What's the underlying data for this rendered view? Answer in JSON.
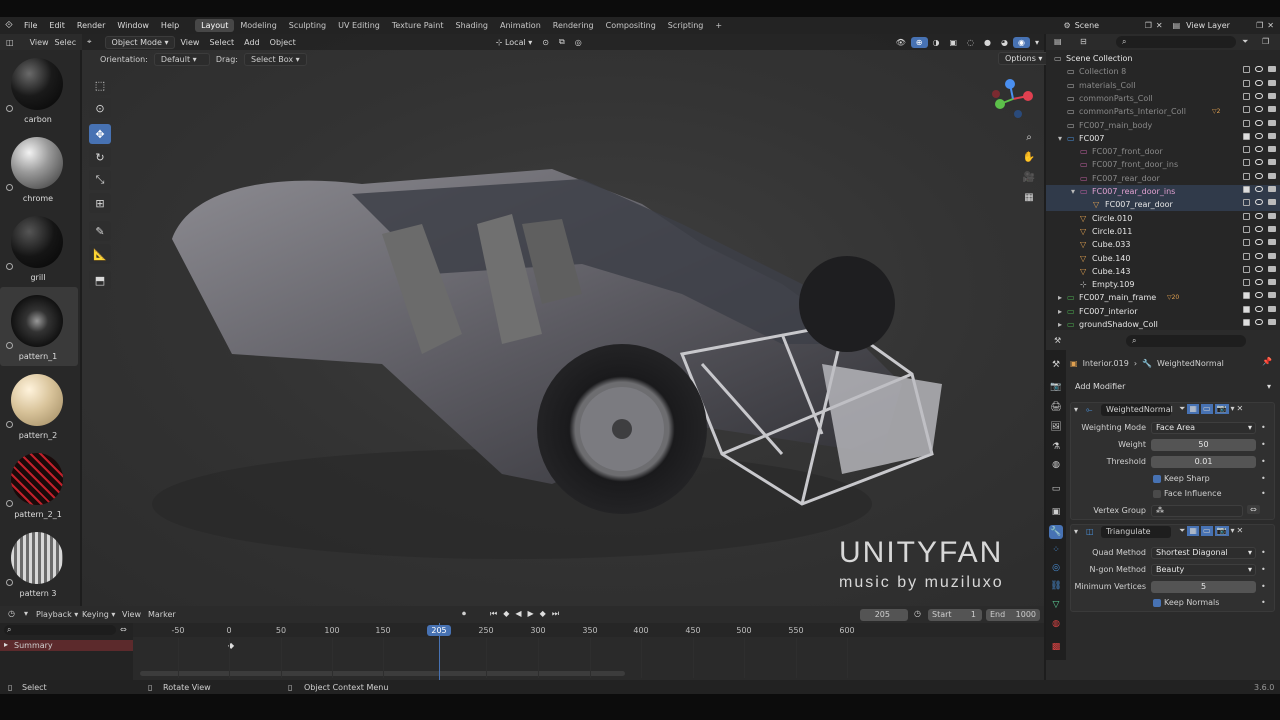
{
  "menubar": {
    "items": [
      "File",
      "Edit",
      "Render",
      "Window",
      "Help"
    ],
    "workspaces": [
      "Layout",
      "Modeling",
      "Sculpting",
      "UV Editing",
      "Texture Paint",
      "Shading",
      "Animation",
      "Rendering",
      "Compositing",
      "Scripting"
    ],
    "active_workspace": "Layout",
    "add_tab": "+",
    "scene": "Scene",
    "view_layer": "View Layer"
  },
  "asset_browser": {
    "view": "View",
    "select": "Selec",
    "materials": [
      {
        "name": "carbon"
      },
      {
        "name": "chrome"
      },
      {
        "name": "grill"
      },
      {
        "name": "pattern_1"
      },
      {
        "name": "pattern_2"
      },
      {
        "name": "pattern_2_1"
      },
      {
        "name": "pattern 3"
      }
    ]
  },
  "viewport": {
    "mode": "Object Mode",
    "menus": [
      "View",
      "Select",
      "Add",
      "Object"
    ],
    "orientation_label": "Orientation:",
    "orientation_value": "Default",
    "drag_label": "Drag:",
    "drag_value": "Select Box",
    "transform_space": "Local",
    "options": "Options",
    "watermark_title": "UNITYFAN",
    "watermark_sub": "music by muziluxo"
  },
  "outliner": {
    "search_placeholder": "",
    "rows": [
      {
        "name": "Scene Collection",
        "depth": 0,
        "type": "scene"
      },
      {
        "name": "Collection 8",
        "depth": 1,
        "type": "coll",
        "dim": true
      },
      {
        "name": "materials_Coll",
        "depth": 1,
        "type": "coll",
        "dim": true
      },
      {
        "name": "commonParts_Coll",
        "depth": 1,
        "type": "coll",
        "dim": true
      },
      {
        "name": "commonParts_Interior_Coll",
        "depth": 1,
        "type": "coll",
        "dim": true,
        "badge": "2"
      },
      {
        "name": "FC007_main_body",
        "depth": 1,
        "type": "coll",
        "dim": true
      },
      {
        "name": "FC007",
        "depth": 1,
        "type": "coll-blue",
        "expanded": true
      },
      {
        "name": "FC007_front_door",
        "depth": 2,
        "type": "coll-pink",
        "dim": true
      },
      {
        "name": "FC007_front_door_ins",
        "depth": 2,
        "type": "coll-pink",
        "dim": true
      },
      {
        "name": "FC007_rear_door",
        "depth": 2,
        "type": "coll-pink",
        "dim": true
      },
      {
        "name": "FC007_rear_door_ins",
        "depth": 2,
        "type": "coll-pink",
        "expanded": true
      },
      {
        "name": "FC007_rear_door",
        "depth": 3,
        "type": "obj"
      },
      {
        "name": "Circle.010",
        "depth": 2,
        "type": "obj"
      },
      {
        "name": "Circle.011",
        "depth": 2,
        "type": "obj"
      },
      {
        "name": "Cube.033",
        "depth": 2,
        "type": "obj"
      },
      {
        "name": "Cube.140",
        "depth": 2,
        "type": "obj"
      },
      {
        "name": "Cube.143",
        "depth": 2,
        "type": "obj"
      },
      {
        "name": "Empty.109",
        "depth": 2,
        "type": "empty"
      },
      {
        "name": "FC007_main_frame",
        "depth": 1,
        "type": "coll-green",
        "badge": "20"
      },
      {
        "name": "FC007_interior",
        "depth": 1,
        "type": "coll-green"
      },
      {
        "name": "groundShadow_Coll",
        "depth": 1,
        "type": "coll-green"
      }
    ]
  },
  "properties": {
    "object": "Interior.019",
    "modifier_context": "WeightedNormal",
    "add_modifier": "Add Modifier",
    "weighted_normal": {
      "name": "WeightedNormal",
      "weighting_mode_label": "Weighting Mode",
      "weighting_mode": "Face Area",
      "weight_label": "Weight",
      "weight": "50",
      "threshold_label": "Threshold",
      "threshold": "0.01",
      "keep_sharp": "Keep Sharp",
      "face_influence": "Face Influence",
      "vertex_group_label": "Vertex Group"
    },
    "triangulate": {
      "name": "Triangulate",
      "quad_method_label": "Quad Method",
      "quad_method": "Shortest Diagonal",
      "ngon_method_label": "N-gon Method",
      "ngon_method": "Beauty",
      "min_vertices_label": "Minimum Vertices",
      "min_vertices": "5",
      "keep_normals": "Keep Normals"
    }
  },
  "timeline": {
    "menus": [
      "Playback",
      "Keying",
      "View",
      "Marker"
    ],
    "current_frame": "205",
    "start_label": "Start",
    "start": "1",
    "end_label": "End",
    "end": "1000",
    "summary": "Summary",
    "ticks": [
      "-50",
      "0",
      "50",
      "100",
      "150",
      "205",
      "250",
      "300",
      "350",
      "400",
      "450",
      "500",
      "550",
      "600"
    ]
  },
  "statusbar": {
    "select": "Select",
    "rotate": "Rotate View",
    "context": "Object Context Menu",
    "version": "3.6.0"
  },
  "colors": {
    "accent": "#4772b3",
    "collection_green": "#4caf50",
    "collection_pink": "#c05fa0",
    "collection_blue": "#4a90d9",
    "mesh_tri": "#5fd39a"
  }
}
